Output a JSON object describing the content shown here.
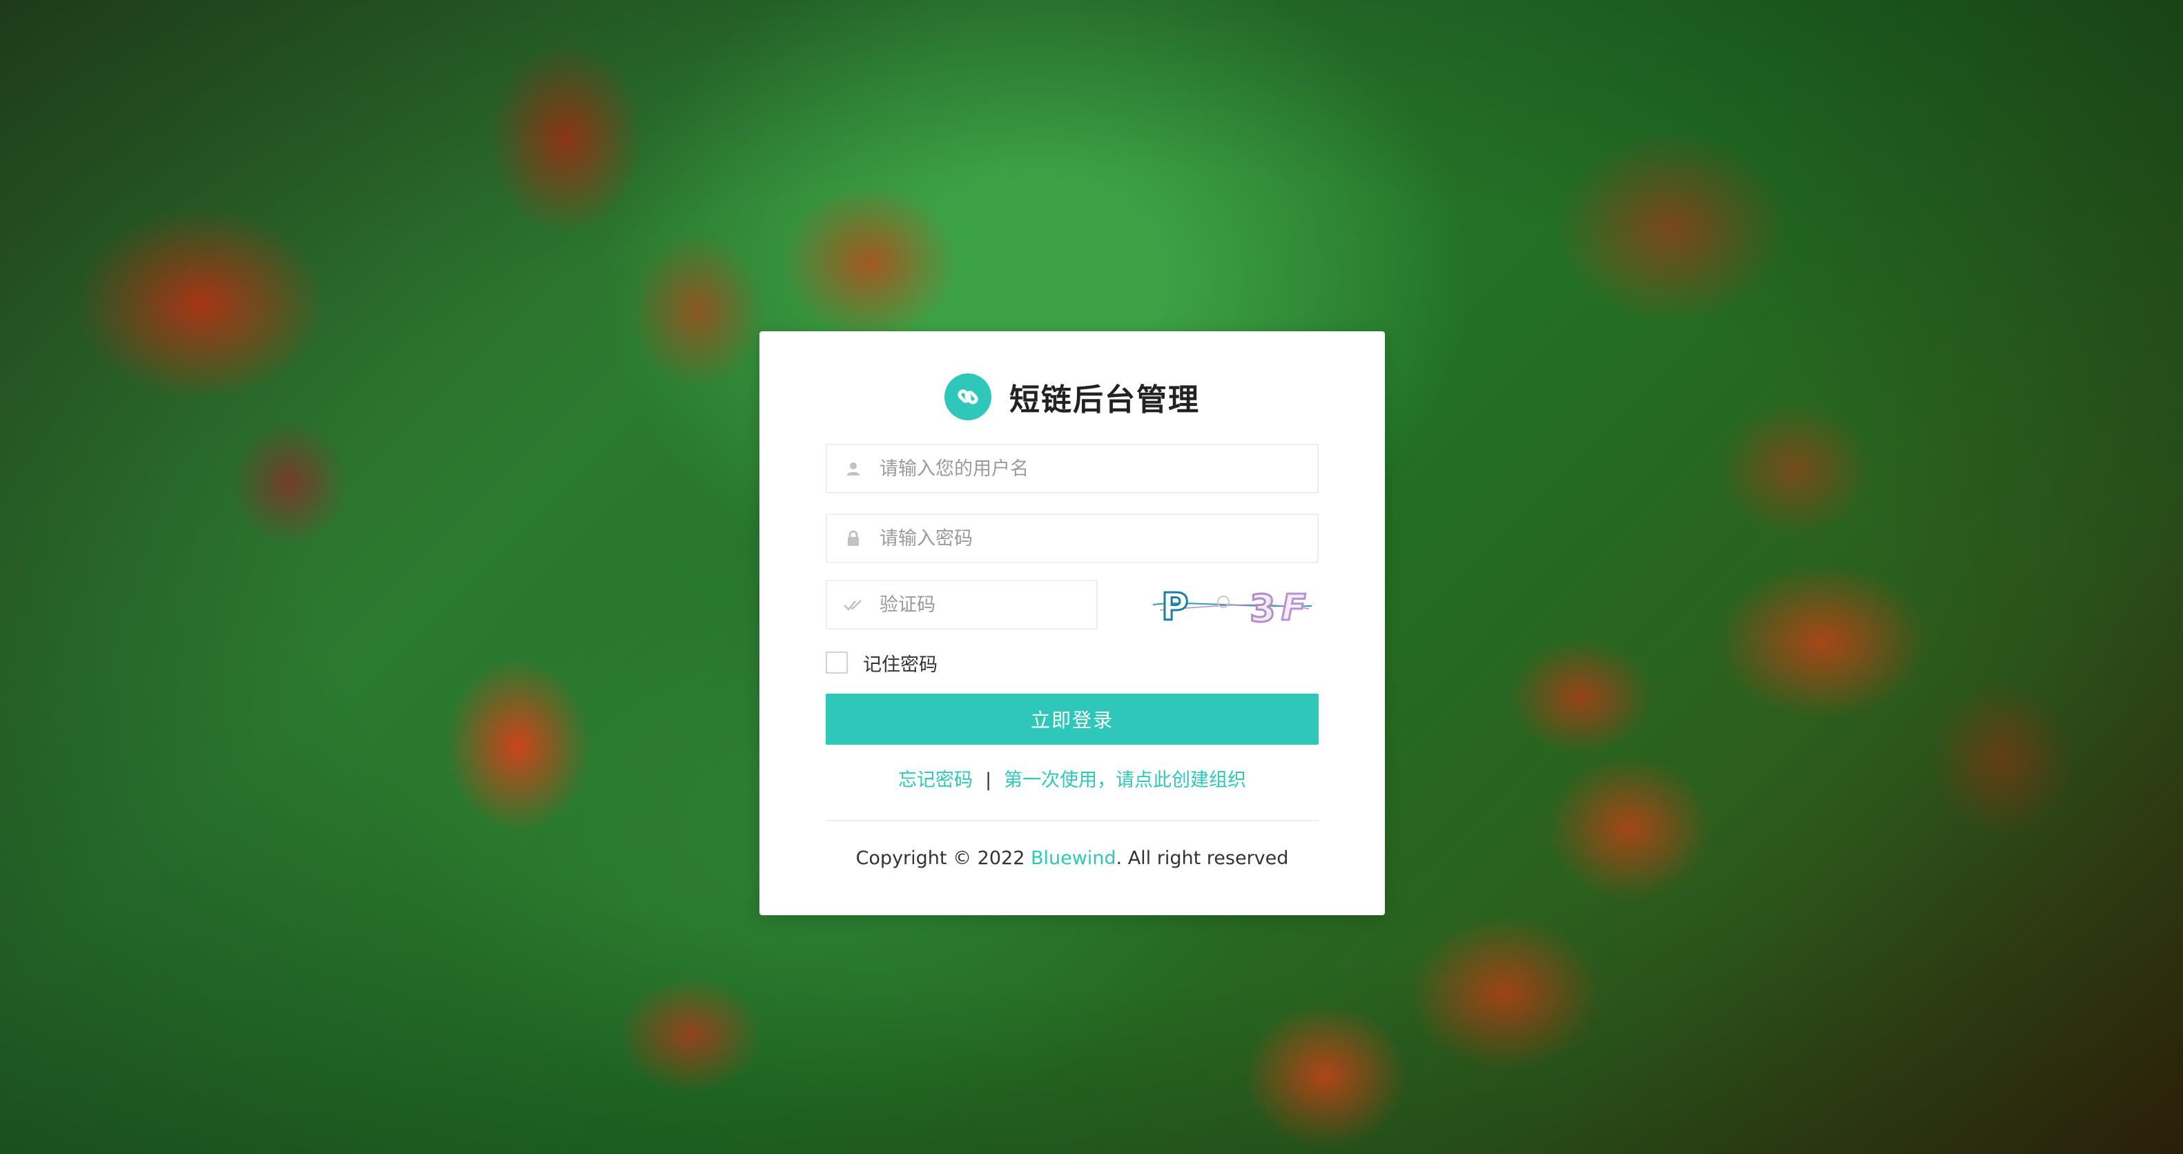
{
  "colors": {
    "accent": "#2ec7b9",
    "icon_gray": "#c2c2c2"
  },
  "header": {
    "logo_icon": "link-icon",
    "title": "短链后台管理"
  },
  "form": {
    "username": {
      "icon": "user-icon",
      "value": "",
      "placeholder": "请输入您的用户名"
    },
    "password": {
      "icon": "lock-icon",
      "value": "",
      "placeholder": "请输入密码"
    },
    "captcha": {
      "icon": "check-icon",
      "value": "",
      "placeholder": "验证码",
      "image_text": "P 3F"
    },
    "remember": {
      "label": "记住密码",
      "checked": false
    },
    "submit_label": "立即登录"
  },
  "links": {
    "forgot": "忘记密码",
    "separator": "|",
    "first_use": "第一次使用，请点此创建组织"
  },
  "footer": {
    "copyright_prefix": "Copyright © 2022 ",
    "brand": "Bluewind",
    "copyright_suffix": ". All right reserved"
  }
}
